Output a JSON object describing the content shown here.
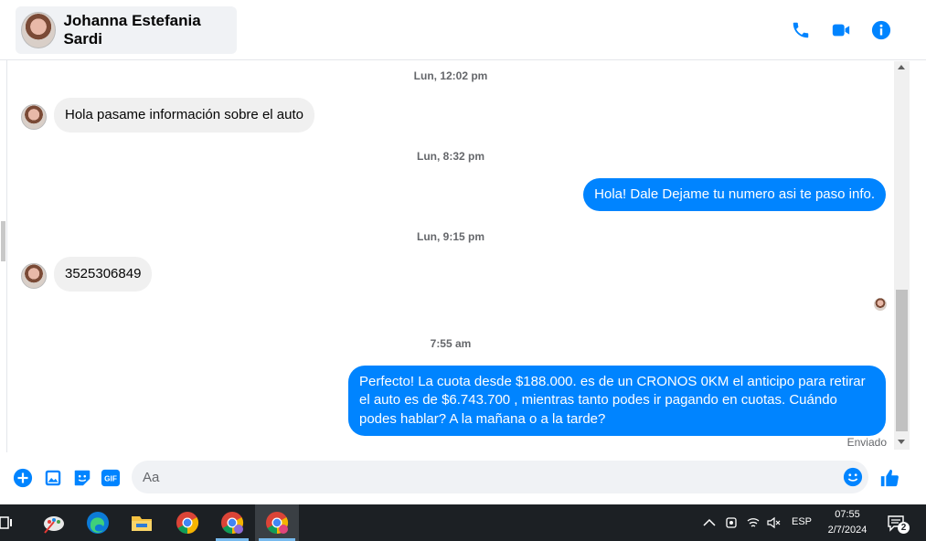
{
  "header": {
    "contact_name": "Johanna Estefania Sardi",
    "actions": [
      "phone-icon",
      "video-icon",
      "info-icon"
    ],
    "accent": "#0084ff"
  },
  "messages": [
    {
      "type": "timestamp",
      "text": "Lun, 12:02 pm"
    },
    {
      "type": "incoming",
      "text": "Hola pasame información sobre el auto"
    },
    {
      "type": "timestamp",
      "text": "Lun, 8:32 pm"
    },
    {
      "type": "outgoing",
      "text": "Hola!  Dale Dejame tu numero  asi te paso info."
    },
    {
      "type": "timestamp",
      "text": "Lun, 9:15 pm"
    },
    {
      "type": "incoming",
      "text": "3525306849"
    },
    {
      "type": "timestamp",
      "text": "7:55 am"
    },
    {
      "type": "outgoing",
      "text": "Perfecto! La cuota desde $188.000. es de un CRONOS 0KM el anticipo para retirar el auto es de $6.743.700 , mientras tanto podes ir pagando en cuotas. Cuándo podes hablar? A la mañana o a la tarde?"
    }
  ],
  "status": {
    "sent_label": "Enviado"
  },
  "composer": {
    "placeholder": "Aa",
    "icons": [
      "plus-icon",
      "gallery-icon",
      "sticker-icon",
      "gif-icon",
      "emoji-icon",
      "like-icon"
    ],
    "gif_label": "GIF"
  },
  "taskbar": {
    "apps": [
      "task-view-icon",
      "paint-icon",
      "edge-icon",
      "file-explorer-icon",
      "chrome-icon",
      "chrome-profile-icon",
      "chrome-active-icon"
    ],
    "language": "ESP",
    "time": "07:55",
    "date": "2/7/2024",
    "notifications_count": "2"
  }
}
